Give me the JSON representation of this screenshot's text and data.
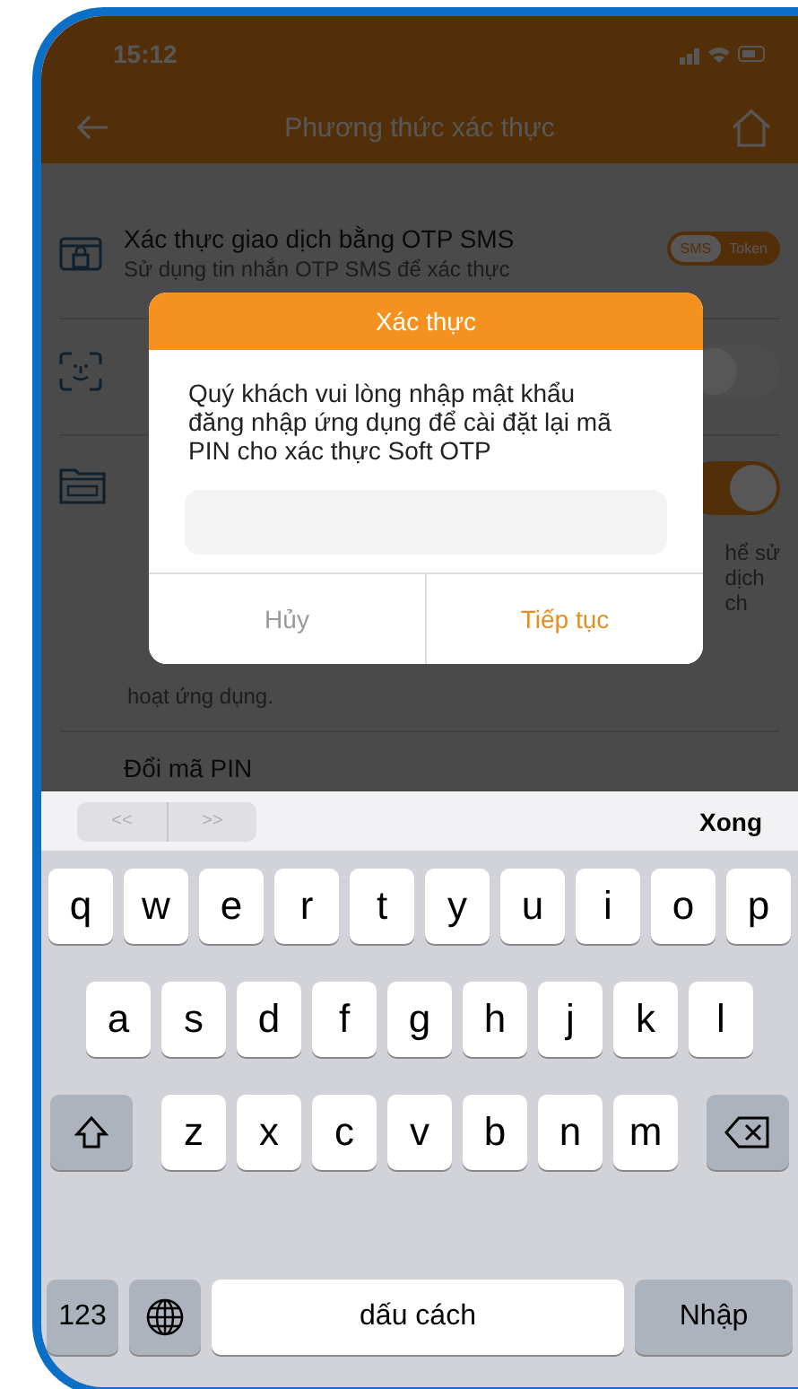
{
  "status_bar": {
    "time": "15:12"
  },
  "header": {
    "title": "Phương thức xác thực"
  },
  "settings": [
    {
      "kind": "switch-text",
      "title": "Xác thực giao dịch bằng OTP SMS",
      "subtitle": "Sử dụng tin nhắn OTP SMS để xác thực",
      "options": [
        {
          "label": "SMS",
          "selected": true
        },
        {
          "label": "Token",
          "selected": false
        }
      ]
    },
    {
      "kind": "switch",
      "on": false
    },
    {
      "kind": "switch",
      "on": true,
      "fragments": [
        "hể sử",
        "dịch",
        "ch"
      ],
      "note": "hoạt ứng dụng."
    },
    {
      "kind": "link",
      "title": "Đổi mã PIN"
    }
  ],
  "dialog": {
    "title": "Xác thực",
    "message": "Quý khách vui lòng nhập mật khẩu đăng nhập ứng dụng để cài đặt lại mã PIN cho xác thực Soft OTP",
    "buttons": [
      {
        "label": "Hủy",
        "kind": "cancel"
      },
      {
        "label": "Tiếp tục",
        "kind": "confirm"
      }
    ]
  },
  "keyboard": {
    "toolbar": {
      "prev": "<<",
      "next": ">>",
      "done": "Xong"
    },
    "rows": [
      [
        "q",
        "w",
        "e",
        "r",
        "t",
        "y",
        "u",
        "i",
        "o",
        "p"
      ],
      [
        "a",
        "s",
        "d",
        "f",
        "g",
        "h",
        "j",
        "k",
        "l"
      ],
      [
        "z",
        "x",
        "c",
        "v",
        "b",
        "n",
        "m"
      ]
    ],
    "numbers": "123",
    "space": "dấu cách",
    "enter": "Nhập"
  }
}
